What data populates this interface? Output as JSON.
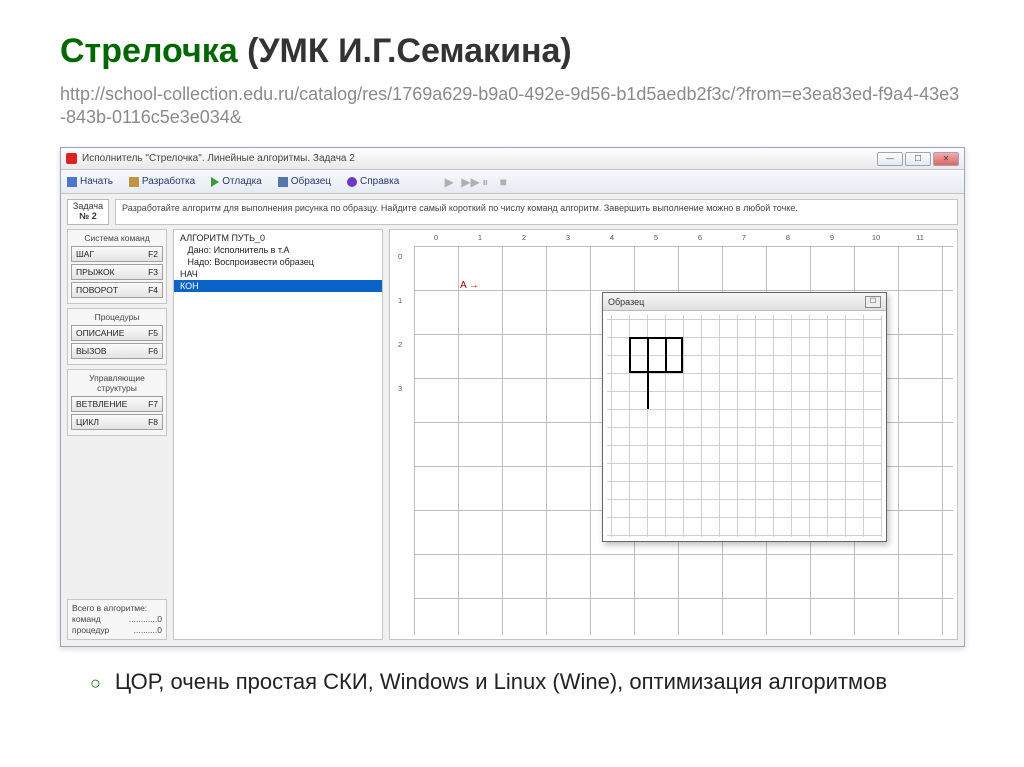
{
  "heading": {
    "title_green": "Стрелочка",
    "title_rest": " (УМК И.Г.Семакина)",
    "url": "http://school-collection.edu.ru/catalog/res/1769a629-b9a0-492e-9d56-b1d5aedb2f3c/?from=e3ea83ed-f9a4-43e3-843b-0116c5e3e034&"
  },
  "window": {
    "title": "Исполнитель \"Стрелочка\". Линейные алгоритмы. Задача 2",
    "menu": {
      "start": "Начать",
      "dev": "Разработка",
      "debug": "Отладка",
      "sample": "Образец",
      "help": "Справка"
    },
    "task": {
      "label": "Задача",
      "num": "№ 2",
      "text": "Разработайте алгоритм для выполнения рисунка по образцу. Найдите самый короткий по числу команд алгоритм. Завершить выполнение можно в любой точке."
    },
    "sidebar": {
      "group1_title": "Система команд",
      "cmds1": [
        {
          "name": "ШАГ",
          "key": "F2"
        },
        {
          "name": "ПРЫЖОК",
          "key": "F3"
        },
        {
          "name": "ПОВОРОТ",
          "key": "F4"
        }
      ],
      "group2_title": "Процедуры",
      "cmds2": [
        {
          "name": "ОПИСАНИЕ",
          "key": "F5"
        },
        {
          "name": "ВЫЗОВ",
          "key": "F6"
        }
      ],
      "group3_title": "Управляющие структуры",
      "cmds3": [
        {
          "name": "ВЕТВЛЕНИЕ",
          "key": "F7"
        },
        {
          "name": "ЦИКЛ",
          "key": "F8"
        }
      ],
      "footer_title": "Всего в алгоритме:",
      "footer_lines": [
        {
          "label": "команд",
          "value": "............0"
        },
        {
          "label": "процедур",
          "value": "..........0"
        }
      ]
    },
    "code": {
      "lines": [
        "АЛГОРИТМ ПУТЬ_0",
        "   Дано: Исполнитель в т.A",
        "   Надо: Воспроизвести образец",
        "НАЧ"
      ],
      "selected": "КОН"
    },
    "ruler_h": [
      "0",
      "1",
      "2",
      "3",
      "4",
      "5",
      "6",
      "7",
      "8",
      "9",
      "10",
      "11"
    ],
    "ruler_v": [
      "0",
      "1",
      "2",
      "3"
    ],
    "arrow": "A →",
    "sample": {
      "title": "Образец"
    }
  },
  "caption": "ЦОР, очень простая СКИ, Windows и Linux (Wine), оптимизация алгоритмов"
}
